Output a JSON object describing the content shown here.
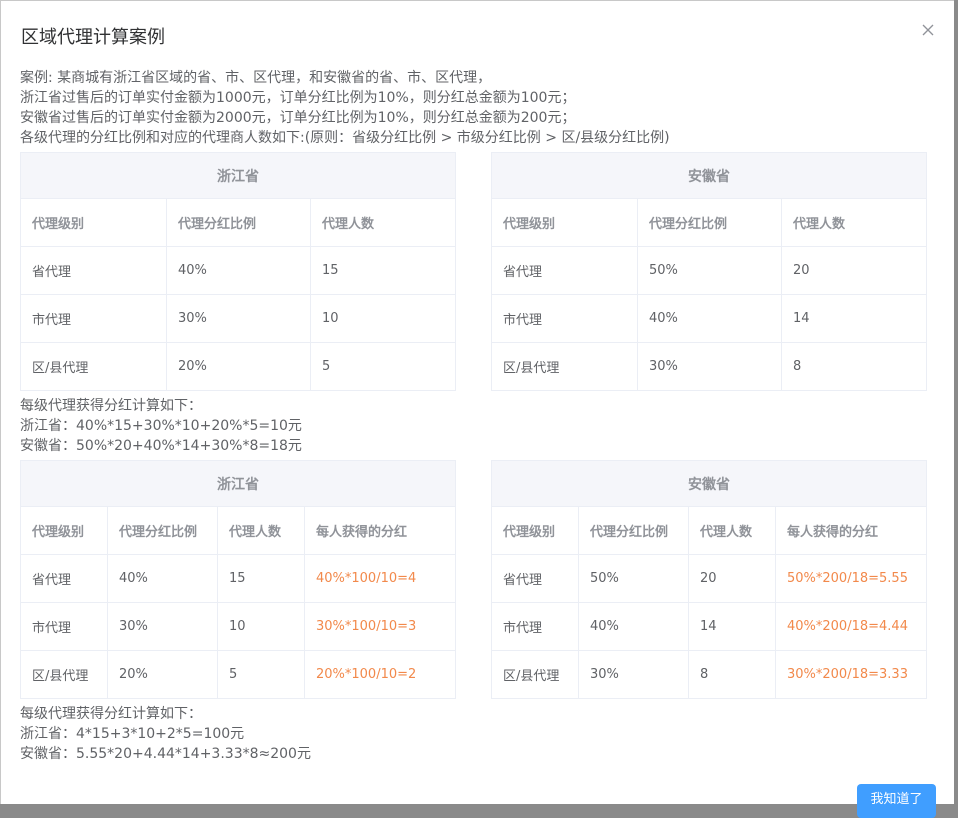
{
  "dialog": {
    "title": "区域代理计算案例",
    "intro": [
      "案例: 某商城有浙江省区域的省、市、区代理，和安徽省的省、市、区代理，",
      "浙江省过售后的订单实付金额为1000元，订单分红比例为10%，则分红总金额为100元；",
      "安徽省过售后的订单实付金额为2000元，订单分红比例为10%，则分红总金额为200元；",
      "各级代理的分红比例和对应的代理商人数如下:(原则：省级分红比例 > 市级分红比例 > 区/县级分红比例)"
    ],
    "summary1": [
      "每级代理获得分红计算如下：",
      "浙江省：40%*15+30%*10+20%*5=10元",
      "安徽省：50%*20+40%*14+30%*8=18元"
    ],
    "summary2": [
      "每级代理获得分红计算如下：",
      "浙江省：4*15+3*10+2*5=100元",
      "安徽省：5.55*20+4.44*14+3.33*8≈200元"
    ],
    "confirm_label": "我知道了"
  },
  "table1_zj": {
    "region": "浙江省",
    "headers": [
      "代理级别",
      "代理分红比例",
      "代理人数"
    ],
    "rows": [
      [
        "省代理",
        "40%",
        "15"
      ],
      [
        "市代理",
        "30%",
        "10"
      ],
      [
        "区/县代理",
        "20%",
        "5"
      ]
    ]
  },
  "table1_ah": {
    "region": "安徽省",
    "headers": [
      "代理级别",
      "代理分红比例",
      "代理人数"
    ],
    "rows": [
      [
        "省代理",
        "50%",
        "20"
      ],
      [
        "市代理",
        "40%",
        "14"
      ],
      [
        "区/县代理",
        "30%",
        "8"
      ]
    ]
  },
  "table2_zj": {
    "region": "浙江省",
    "headers": [
      "代理级别",
      "代理分红比例",
      "代理人数",
      "每人获得的分红"
    ],
    "rows": [
      [
        "省代理",
        "40%",
        "15",
        "40%*100/10=4"
      ],
      [
        "市代理",
        "30%",
        "10",
        "30%*100/10=3"
      ],
      [
        "区/县代理",
        "20%",
        "5",
        "20%*100/10=2"
      ]
    ]
  },
  "table2_ah": {
    "region": "安徽省",
    "headers": [
      "代理级别",
      "代理分红比例",
      "代理人数",
      "每人获得的分红"
    ],
    "rows": [
      [
        "省代理",
        "50%",
        "20",
        "50%*200/18=5.55"
      ],
      [
        "市代理",
        "40%",
        "14",
        "40%*200/18=4.44"
      ],
      [
        "区/县代理",
        "30%",
        "8",
        "30%*200/18=3.33"
      ]
    ]
  },
  "colors": {
    "accent": "#409eff",
    "highlight": "#f2894b",
    "header_bg": "#f5f6fa",
    "border": "#ebeef5"
  },
  "icons": {
    "close": "close-icon"
  }
}
